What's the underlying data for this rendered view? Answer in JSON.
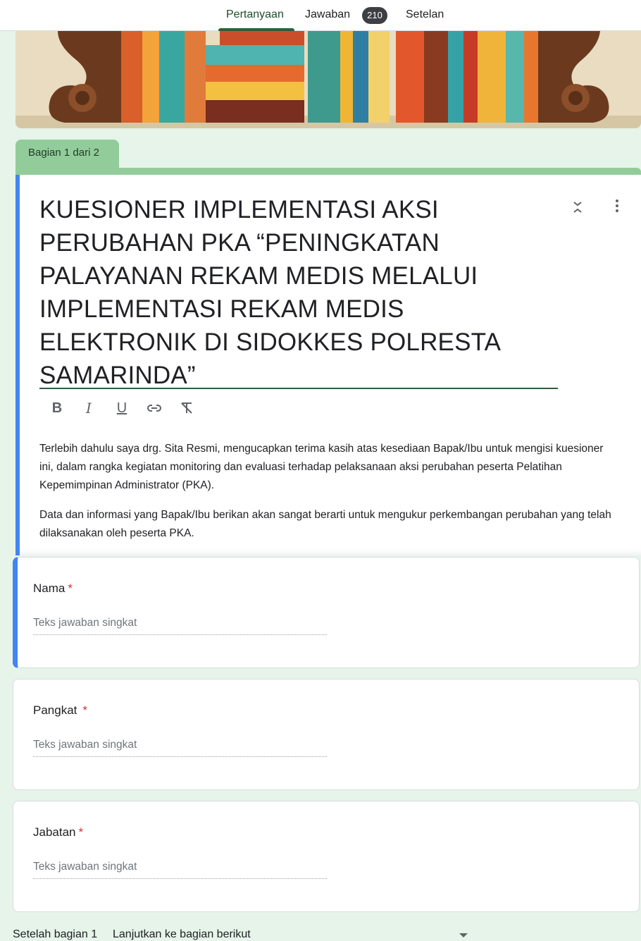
{
  "tabs": [
    {
      "label": "Pertanyaan",
      "active": true
    },
    {
      "label": "Jawaban",
      "badge": "210"
    },
    {
      "label": "Setelan"
    }
  ],
  "section": {
    "label": "Bagian 1 dari 2"
  },
  "form": {
    "title": "KUESIONER IMPLEMENTASI AKSI PERUBAHAN PKA “PENINGKATAN PALAYANAN REKAM MEDIS MELALUI IMPLEMENTASI REKAM MEDIS ELEKTRONIK DI SIDOKKES POLRESTA SAMARINDA”",
    "description": [
      "Terlebih dahulu saya drg. Sita Resmi, mengucapkan terima kasih atas kesediaan Bapak/Ibu untuk mengisi kuesioner ini, dalam rangka kegiatan monitoring dan evaluasi terhadap pelaksanaan aksi perubahan peserta Pelatihan Kepemimpinan Administrator (PKA).",
      "Data dan informasi yang Bapak/Ibu berikan akan sangat berarti untuk mengukur perkembangan perubahan yang telah dilaksanakan oleh peserta PKA."
    ]
  },
  "toolbar": {
    "bold": "B",
    "italic": "I",
    "underline": "U",
    "icons": [
      "bold-icon",
      "italic-icon",
      "underline-icon",
      "link-icon",
      "clear-format-icon"
    ]
  },
  "questions": [
    {
      "label": "Nama",
      "required": "*",
      "placeholder": "Teks jawaban singkat"
    },
    {
      "label": "Pangkat",
      "required": "*",
      "placeholder": "Teks jawaban singkat"
    },
    {
      "label": "Jabatan",
      "required": "*",
      "placeholder": "Teks jawaban singkat"
    }
  ],
  "footer": {
    "label": "Setelah bagian 1",
    "value": "Lanjutkan ke bagian berikut"
  },
  "colors": {
    "accent_blue": "#4285f4",
    "theme_green": "#93cc9b",
    "background": "#e6f4ea",
    "required_red": "#d93025"
  }
}
